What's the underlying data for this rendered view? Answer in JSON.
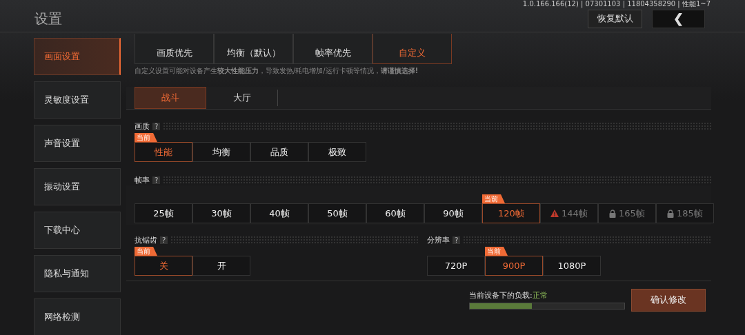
{
  "header": {
    "title": "设置",
    "version": "1.0.166.166(12) | 07301103 | 11804358290 | 性能1~7",
    "reset_button": "恢复默认",
    "back_button": "❮"
  },
  "sidebar": {
    "items": [
      {
        "label": "画面设置",
        "selected": true
      },
      {
        "label": "灵敏度设置",
        "selected": false
      },
      {
        "label": "声音设置",
        "selected": false
      },
      {
        "label": "振动设置",
        "selected": false
      },
      {
        "label": "下载中心",
        "selected": false
      },
      {
        "label": "隐私与通知",
        "selected": false
      },
      {
        "label": "网络检测",
        "selected": false
      }
    ]
  },
  "presets": [
    {
      "label": "画质优先",
      "selected": false
    },
    {
      "label": "均衡（默认）",
      "selected": false
    },
    {
      "label": "帧率优先",
      "selected": false
    },
    {
      "label": "自定义",
      "selected": true
    }
  ],
  "warning": "自定义设置可能对设备产生**较大性能压力**，导致发热/耗电增加/运行卡顿等情况，**请谨慎选择!**",
  "tabs": [
    {
      "label": "战斗",
      "selected": true
    },
    {
      "label": "大厅",
      "selected": false
    }
  ],
  "quality": {
    "label": "画质",
    "help": "?",
    "badge": "当前",
    "options": [
      {
        "label": "性能",
        "selected": true
      },
      {
        "label": "均衡",
        "selected": false
      },
      {
        "label": "品质",
        "selected": false
      },
      {
        "label": "极致",
        "selected": false
      }
    ]
  },
  "frame_rate": {
    "label": "帧率",
    "help": "?",
    "badge": "当前",
    "options": [
      {
        "label": "25帧",
        "selected": false,
        "kind": "normal"
      },
      {
        "label": "30帧",
        "selected": false,
        "kind": "normal"
      },
      {
        "label": "40帧",
        "selected": false,
        "kind": "normal"
      },
      {
        "label": "50帧",
        "selected": false,
        "kind": "normal"
      },
      {
        "label": "60帧",
        "selected": false,
        "kind": "normal"
      },
      {
        "label": "90帧",
        "selected": false,
        "kind": "normal"
      },
      {
        "label": "120帧",
        "selected": true,
        "kind": "normal"
      },
      {
        "label": "144帧",
        "selected": false,
        "kind": "warning"
      },
      {
        "label": "165帧",
        "selected": false,
        "kind": "locked"
      },
      {
        "label": "185帧",
        "selected": false,
        "kind": "locked"
      }
    ]
  },
  "anti_aliasing": {
    "label": "抗锯齿",
    "help": "?",
    "badge": "当前",
    "options": [
      {
        "label": "关",
        "selected": true
      },
      {
        "label": "开",
        "selected": false
      }
    ]
  },
  "resolution": {
    "label": "分辨率",
    "help": "?",
    "badge": "当前",
    "options": [
      {
        "label": "720P",
        "selected": false
      },
      {
        "label": "900P",
        "selected": true
      },
      {
        "label": "1080P",
        "selected": false
      }
    ]
  },
  "footer": {
    "load_label": "当前设备下的负载:",
    "load_status": "正常",
    "level": 0.4,
    "confirm_button": "确认修改"
  }
}
